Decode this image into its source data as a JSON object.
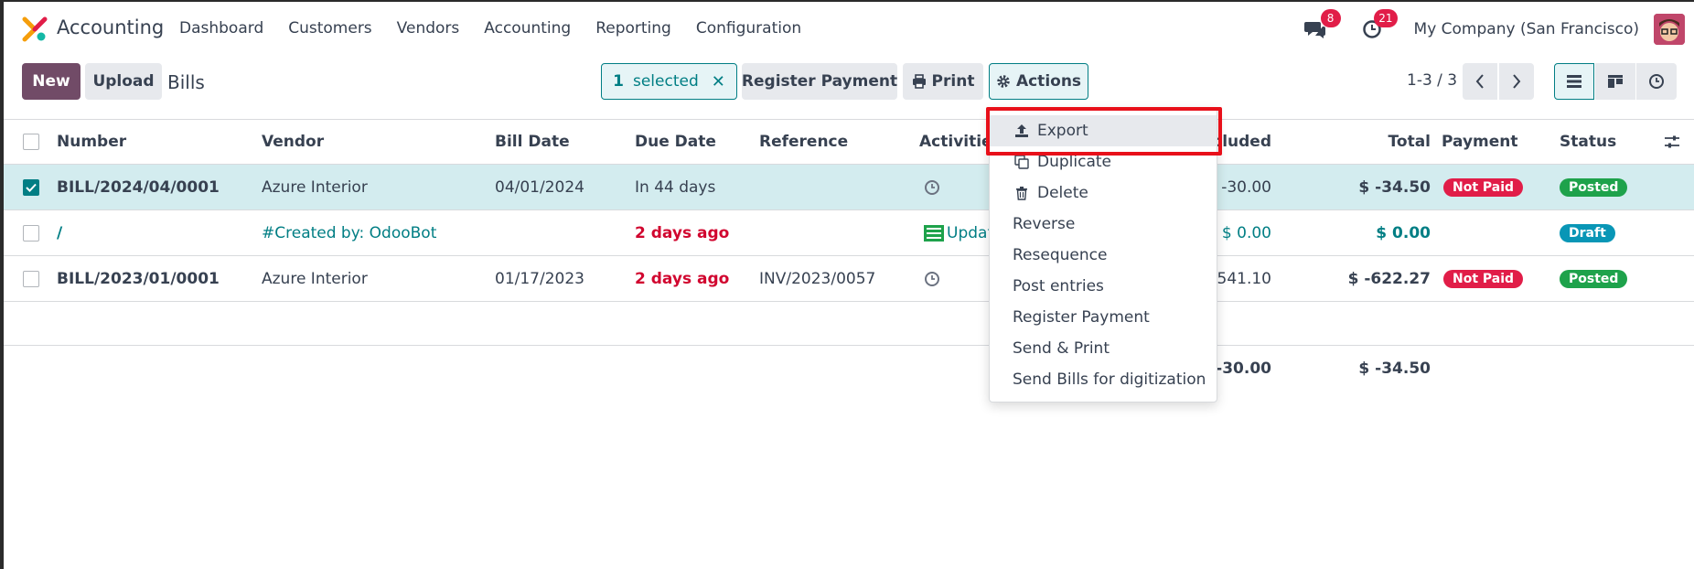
{
  "navbar": {
    "app_name": "Accounting",
    "menu": [
      "Dashboard",
      "Customers",
      "Vendors",
      "Accounting",
      "Reporting",
      "Configuration"
    ],
    "messages_count": "8",
    "activities_count": "21",
    "company": "My Company (San Francisco)"
  },
  "control_panel": {
    "new_label": "New",
    "upload_label": "Upload",
    "title": "Bills",
    "selected_count": "1",
    "selected_text": "selected",
    "register_payment_label": "Register Payment",
    "print_label": "Print",
    "actions_label": "Actions",
    "pager": "1-3 / 3"
  },
  "table": {
    "headers": {
      "number": "Number",
      "vendor": "Vendor",
      "bill_date": "Bill Date",
      "due_date": "Due Date",
      "reference": "Reference",
      "activities": "Activities",
      "tax_excluded": "cluded",
      "total": "Total",
      "payment": "Payment",
      "status": "Status"
    },
    "rows": [
      {
        "number": "BILL/2024/04/0001",
        "vendor": "Azure Interior",
        "bill_date": "04/01/2024",
        "due_date": "In 44 days",
        "reference": "",
        "activity": "",
        "tax_excluded": "$ -30.00",
        "total": "$ -34.50",
        "payment": "Not Paid",
        "status": "Posted",
        "selected": true
      },
      {
        "number": "/",
        "vendor": "#Created by: OdooBot",
        "bill_date": "",
        "due_date": "2 days ago",
        "reference": "",
        "activity": "Updat",
        "tax_excluded": "$ 0.00",
        "total": "$ 0.00",
        "payment": "",
        "status": "Draft",
        "selected": false
      },
      {
        "number": "BILL/2023/01/0001",
        "vendor": "Azure Interior",
        "bill_date": "01/17/2023",
        "due_date": "2 days ago",
        "reference": "INV/2023/0057",
        "activity": "",
        "tax_excluded": "-541.10",
        "total": "$ -622.27",
        "payment": "Not Paid",
        "status": "Posted",
        "selected": false
      }
    ],
    "totals": {
      "tax_excluded": "$ -30.00",
      "total": "$ -34.50"
    }
  },
  "actions_menu": {
    "items": [
      "Export",
      "Duplicate",
      "Delete",
      "Reverse",
      "Resequence",
      "Post entries",
      "Register Payment",
      "Send & Print",
      "Send Bills for digitization"
    ]
  },
  "colors": {
    "brand": "#714b67",
    "accent": "#017e84",
    "danger": "#e11d48",
    "success": "#1ea24b",
    "highlight_box": "#e8101a"
  }
}
